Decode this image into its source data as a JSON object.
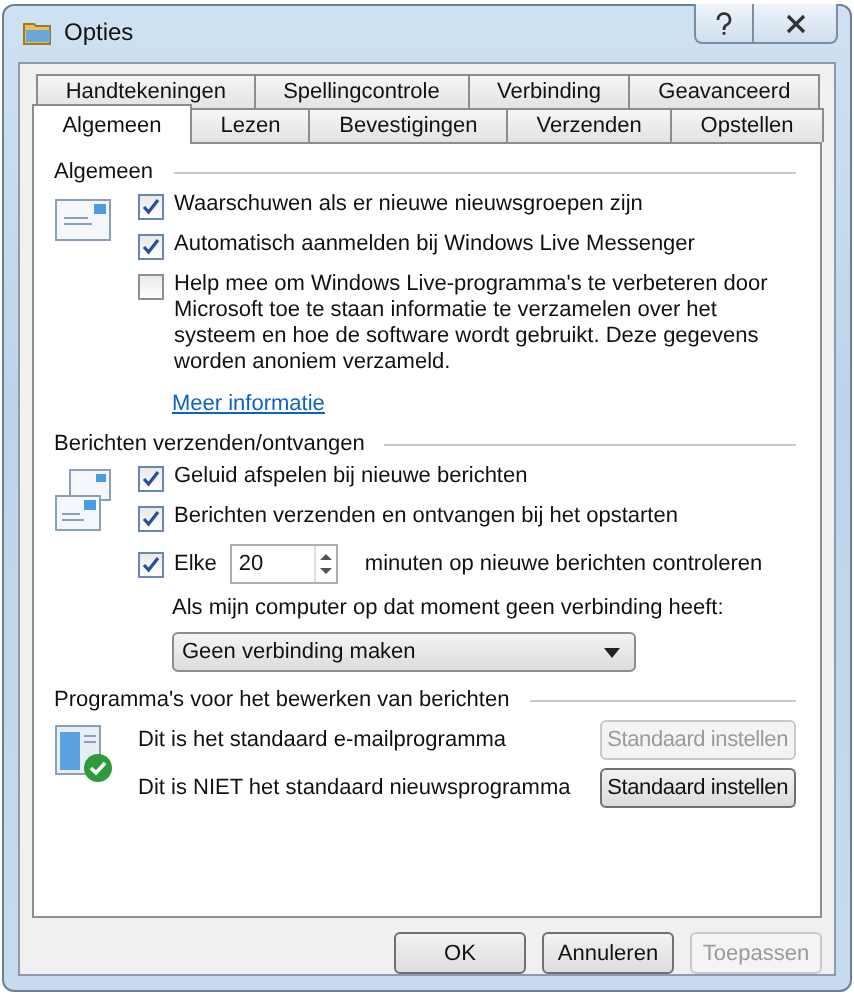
{
  "window": {
    "title": "Opties"
  },
  "tab_rows": [
    [
      {
        "label": "Handtekeningen",
        "selected": false
      },
      {
        "label": "Spellingcontrole",
        "selected": false
      },
      {
        "label": "Verbinding",
        "selected": false
      },
      {
        "label": "Geavanceerd",
        "selected": false
      }
    ],
    [
      {
        "label": "Algemeen",
        "selected": true
      },
      {
        "label": "Lezen",
        "selected": false
      },
      {
        "label": "Bevestigingen",
        "selected": false
      },
      {
        "label": "Verzenden",
        "selected": false
      },
      {
        "label": "Opstellen",
        "selected": false
      }
    ]
  ],
  "general": {
    "title": "Algemeen",
    "options": [
      {
        "label": "Waarschuwen als er nieuwe nieuwsgroepen zijn",
        "checked": true
      },
      {
        "label": "Automatisch aanmelden bij Windows Live Messenger",
        "checked": true
      },
      {
        "label": "Help mee om Windows Live-programma's te verbeteren door Microsoft toe te staan informatie te verzamelen over het systeem en hoe de software wordt gebruikt. Deze gegevens worden anoniem verzameld.",
        "checked": false
      }
    ],
    "link": "Meer informatie"
  },
  "send_receive": {
    "title": "Berichten verzenden/ontvangen",
    "options": [
      {
        "label": "Geluid afspelen bij nieuwe berichten",
        "checked": true
      },
      {
        "label": "Berichten verzenden en ontvangen bij het opstarten",
        "checked": true
      }
    ],
    "interval": {
      "checked": true,
      "label": "Elke",
      "value": "20",
      "suffix": "minuten op nieuwe berichten controleren"
    },
    "offline_label": "Als mijn computer op dat moment geen verbinding heeft:",
    "offline_choice": "Geen verbinding maken"
  },
  "programs": {
    "title": "Programma's voor het bewerken van berichten",
    "rows": [
      {
        "text": "Dit is het standaard e-mailprogramma",
        "button": "Standaard instellen",
        "disabled": true
      },
      {
        "text": "Dit is NIET het standaard nieuwsprogramma",
        "button": "Standaard instellen",
        "disabled": false
      }
    ]
  },
  "buttons": [
    {
      "label": "OK",
      "disabled": false
    },
    {
      "label": "Annuleren",
      "disabled": false
    },
    {
      "label": "Toepassen",
      "disabled": true
    }
  ]
}
